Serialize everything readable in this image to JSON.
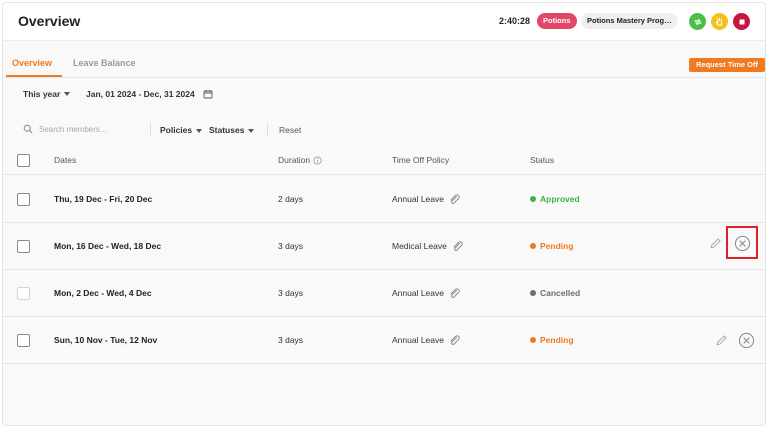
{
  "header": {
    "title": "Overview",
    "timer": "2:40:28",
    "project_pill": "Potions",
    "task_pill": "Potions Mastery Progr...",
    "colors": {
      "project": "#e2476a",
      "start": "#4cbf4a",
      "hand": "#f2c21b",
      "stop": "#c8173f"
    }
  },
  "tabs": [
    {
      "label": "Overview",
      "active": true
    },
    {
      "label": "Leave Balance",
      "active": false
    }
  ],
  "actions": {
    "request_time_off": "Request Time Off"
  },
  "filters": {
    "period": "This year",
    "date_range": "Jan, 01 2024 - Dec, 31 2024"
  },
  "search": {
    "placeholder": "Search members...",
    "policies": "Policies",
    "statuses": "Statuses",
    "reset": "Reset"
  },
  "table": {
    "headers": {
      "dates": "Dates",
      "duration": "Duration",
      "policy": "Time Off Policy",
      "status": "Status"
    },
    "rows": [
      {
        "dates": "Thu, 19 Dec - Fri, 20 Dec",
        "duration": "2 days",
        "policy": "Annual Leave",
        "status": "Approved",
        "status_color": "#3cb44b"
      },
      {
        "dates": "Mon, 16 Dec - Wed, 18 Dec",
        "duration": "3 days",
        "policy": "Medical Leave",
        "status": "Pending",
        "status_color": "#f07a1f"
      },
      {
        "dates": "Mon, 2 Dec - Wed, 4 Dec",
        "duration": "3 days",
        "policy": "Annual Leave",
        "status": "Cancelled",
        "status_color": "#6e6e6e"
      },
      {
        "dates": "Sun, 10 Nov - Tue, 12 Nov",
        "duration": "3 days",
        "policy": "Annual Leave",
        "status": "Pending",
        "status_color": "#f07a1f"
      }
    ]
  }
}
